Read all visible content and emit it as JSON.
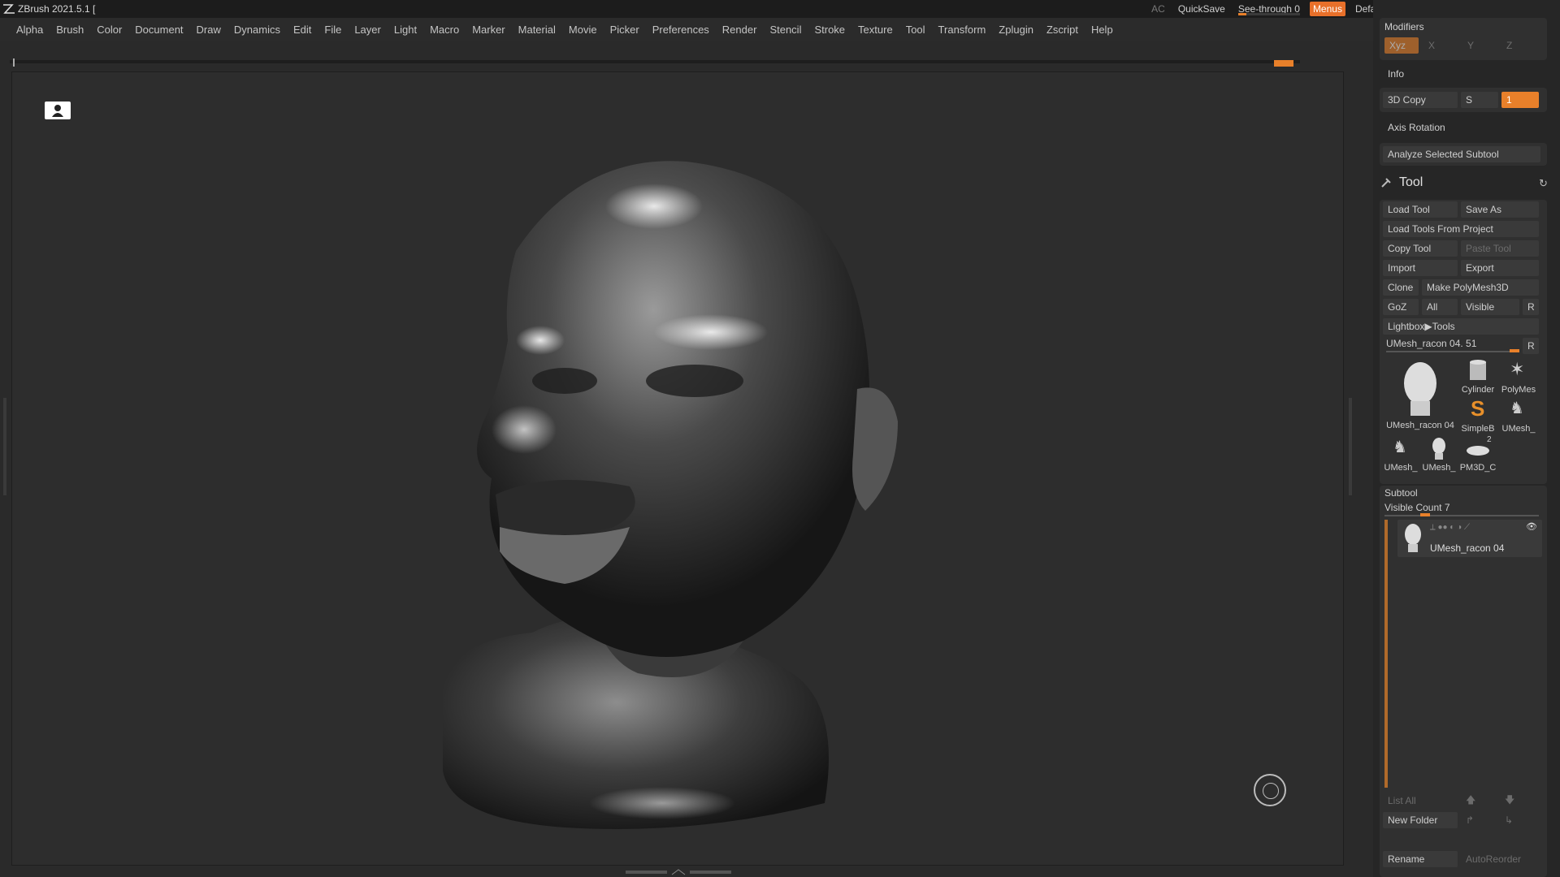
{
  "titlebar": {
    "app_title": "ZBrush 2021.5.1 [",
    "ac": "AC",
    "quicksave": "QuickSave",
    "see_through_label": "See-through",
    "see_through_value": "0",
    "menus_label": "Menus",
    "script_label": "DefaultZScript"
  },
  "menubar": {
    "items": [
      "Alpha",
      "Brush",
      "Color",
      "Document",
      "Draw",
      "Dynamics",
      "Edit",
      "File",
      "Layer",
      "Light",
      "Macro",
      "Marker",
      "Material",
      "Movie",
      "Picker",
      "Preferences",
      "Render",
      "Stencil",
      "Stroke",
      "Texture",
      "Tool",
      "Transform",
      "Zplugin",
      "Zscript",
      "Help"
    ]
  },
  "panel": {
    "modifiers_label": "Modifiers",
    "xyz": "Xyz",
    "x": "X",
    "y": "Y",
    "z": "Z",
    "info_label": "Info",
    "copy3d_label": "3D Copy",
    "s_label": "S",
    "copy3d_value": "1",
    "axis_rotation_label": "Axis Rotation",
    "analyze_label": "Analyze Selected Subtool",
    "tool_label": "Tool",
    "load_tool": "Load Tool",
    "save_as": "Save As",
    "load_tools_from_project": "Load Tools From Project",
    "copy_tool": "Copy Tool",
    "paste_tool": "Paste Tool",
    "import": "Import",
    "export": "Export",
    "clone": "Clone",
    "make_polymesh": "Make PolyMesh3D",
    "goz": "GoZ",
    "all": "All",
    "visible": "Visible",
    "r": "R",
    "lightbox_tools": "Lightbox▶Tools",
    "current_tool": "UMesh_racon 04. 51",
    "thumbs": [
      {
        "label": "UMesh_racon 04"
      },
      {
        "label": "Cylinder"
      },
      {
        "label": "PolyMes"
      },
      {
        "label": "SimpleB"
      },
      {
        "label": "UMesh_"
      },
      {
        "label": "UMesh_"
      },
      {
        "label": "UMesh_"
      },
      {
        "label": "PM3D_C"
      }
    ],
    "thumb_badge": "2",
    "subtool_label": "Subtool",
    "visible_count": "Visible Count 7",
    "subtool_item": "UMesh_racon 04",
    "list_all": "List All",
    "new_folder": "New Folder",
    "rename": "Rename",
    "autoreorder": "AutoReorder"
  },
  "colors": {
    "accent": "#e8802a",
    "background": "#2d2d2d",
    "panel": "#262626"
  }
}
